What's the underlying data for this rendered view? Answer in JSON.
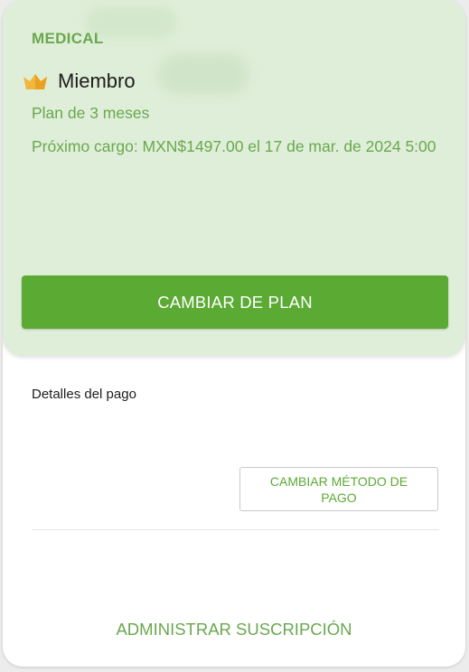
{
  "colors": {
    "accent_green": "#6aa84f",
    "button_green": "#5aaa34",
    "panel_background": "#dfeed8",
    "crown_gold": "#f2b63c"
  },
  "plan": {
    "brand": "MEDICAL",
    "crown_icon": "crown-icon",
    "membership_label": "Miembro",
    "duration": "Plan de 3 meses",
    "next_charge": "Próximo cargo: MXN$1497.00 el 17 de mar. de 2024 5:00",
    "change_plan_label": "CAMBIAR DE PLAN"
  },
  "payment": {
    "title": "Detalles del pago",
    "change_method_label": "CAMBIAR MÉTODO DE PAGO"
  },
  "footer": {
    "manage_subscription_label": "ADMINISTRAR SUSCRIPCIÓN"
  }
}
